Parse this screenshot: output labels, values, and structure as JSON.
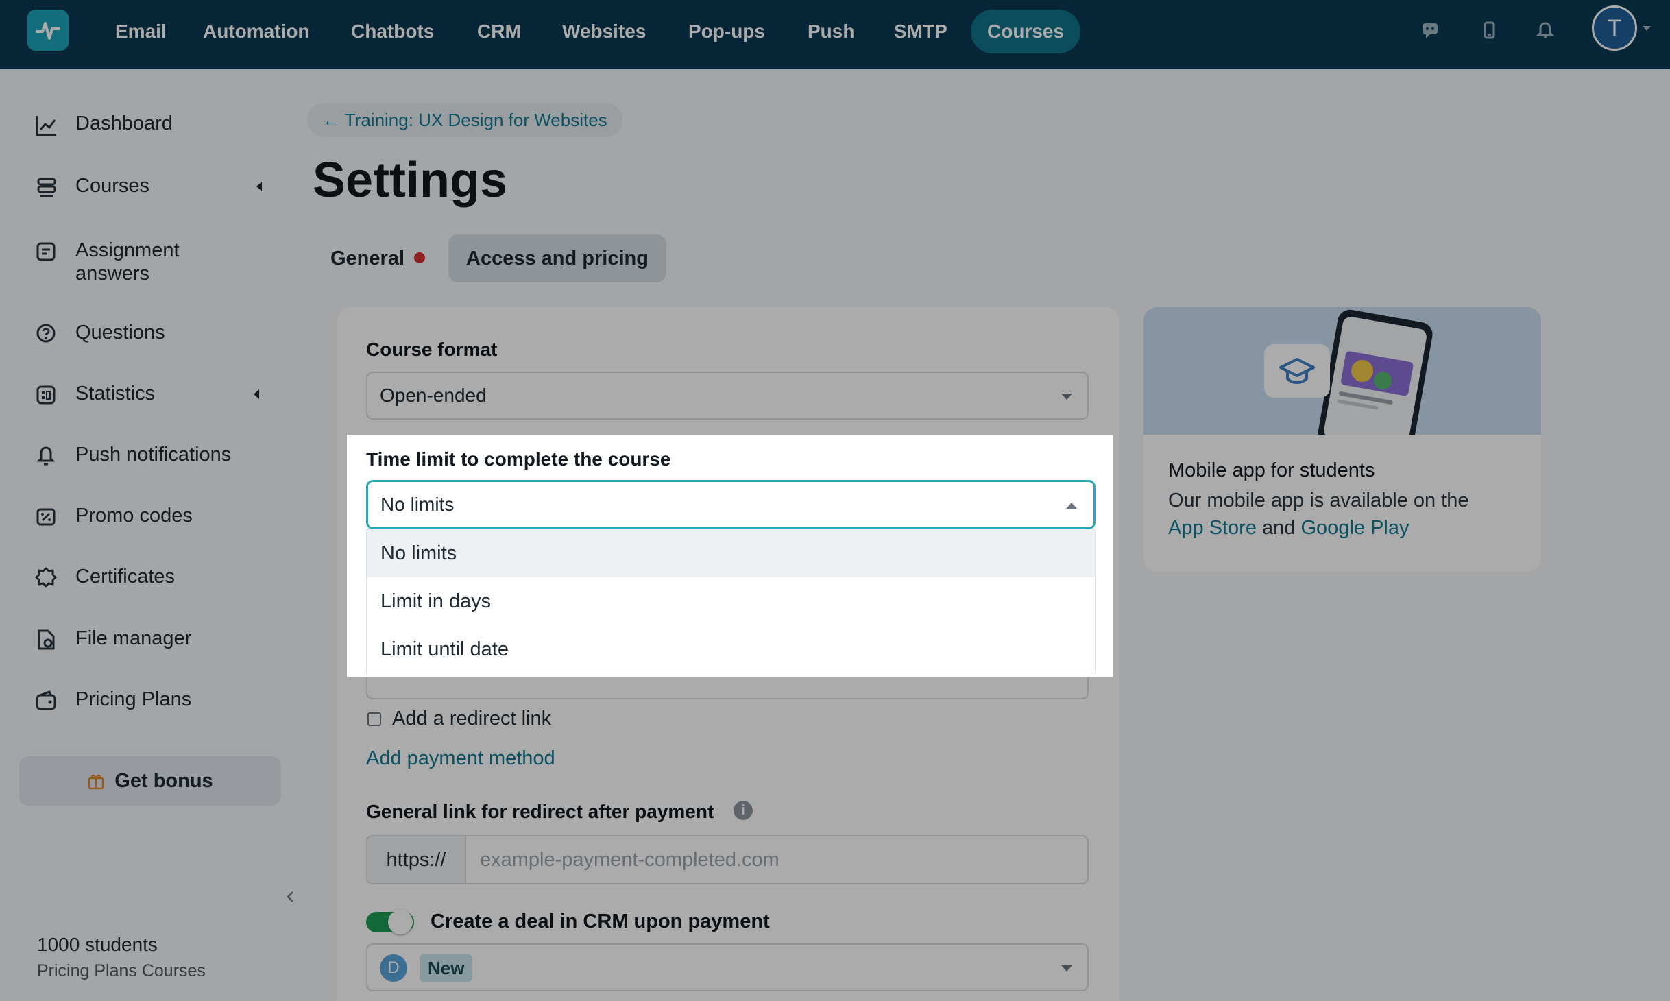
{
  "topnav": {
    "items": [
      "Email",
      "Automation",
      "Chatbots",
      "CRM",
      "Websites",
      "Pop-ups",
      "Push",
      "SMTP",
      "Courses"
    ],
    "active": "Courses",
    "avatar_letter": "T"
  },
  "sidebar": {
    "items": [
      {
        "label": "Dashboard",
        "icon": "chart-line-icon"
      },
      {
        "label": "Courses",
        "icon": "stack-icon",
        "expandable": true
      },
      {
        "label": "Assignment answers",
        "icon": "assignment-icon"
      },
      {
        "label": "Questions",
        "icon": "question-icon"
      },
      {
        "label": "Statistics",
        "icon": "statistics-icon",
        "expandable": true
      },
      {
        "label": "Push notifications",
        "icon": "bell-icon"
      },
      {
        "label": "Promo codes",
        "icon": "promo-icon"
      },
      {
        "label": "Certificates",
        "icon": "certificate-icon"
      },
      {
        "label": "File manager",
        "icon": "file-icon"
      },
      {
        "label": "Pricing Plans",
        "icon": "wallet-icon"
      }
    ],
    "bonus_label": "Get bonus",
    "plan_students": "1000 students",
    "plan_name": "Pricing Plans Courses"
  },
  "main": {
    "breadcrumb": "← Training: UX Design for Websites",
    "title": "Settings",
    "tabs": [
      {
        "label": "General",
        "has_alert": true
      },
      {
        "label": "Access and pricing",
        "active": true
      }
    ],
    "course_format": {
      "label": "Course format",
      "value": "Open-ended"
    },
    "time_limit": {
      "label": "Time limit to complete the course",
      "value": "No limits",
      "options": [
        "No limits",
        "Limit in days",
        "Limit until date"
      ]
    },
    "redirect_checkbox_label": "Add a redirect link",
    "add_payment_label": "Add payment method",
    "redirect": {
      "label": "General link for redirect after payment",
      "prefix": "https://",
      "placeholder": "example-payment-completed.com"
    },
    "deal": {
      "label": "Create a deal in CRM upon payment",
      "avatar": "D",
      "stage": "New"
    }
  },
  "promo": {
    "title": "Mobile app for students",
    "text_prefix": "Our mobile app is available on the",
    "app_store": "App Store",
    "and": "and",
    "google_play": "Google Play"
  },
  "colors": {
    "nav_bg": "#0b3a53",
    "accent": "#127b93",
    "focus": "#2aa7b8",
    "toggle_on": "#1f9d55"
  }
}
